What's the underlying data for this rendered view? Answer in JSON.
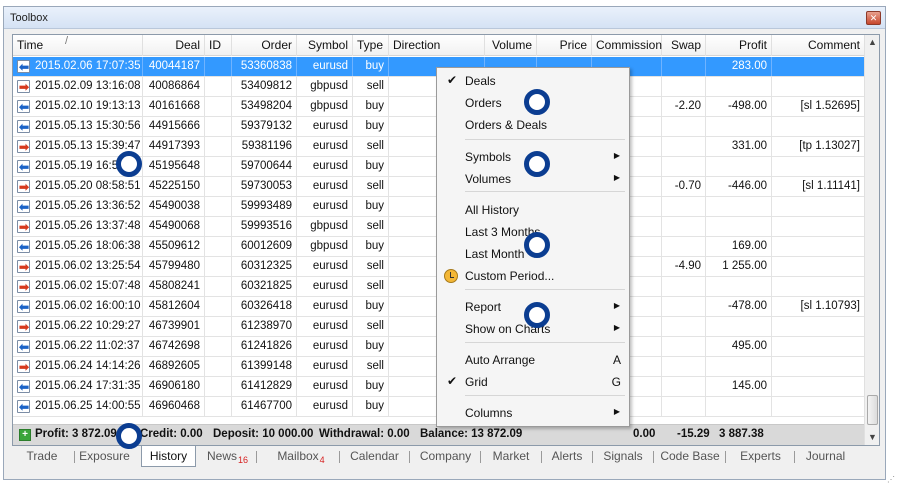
{
  "window": {
    "title": "Toolbox",
    "close_icon": "close-icon"
  },
  "columns": [
    "Time",
    "Deal",
    "ID",
    "Order",
    "Symbol",
    "Type",
    "Direction",
    "Volume",
    "Price",
    "Commission",
    "Swap",
    "Profit",
    "Comment"
  ],
  "sort_indicator": "/",
  "rows": [
    {
      "time": "2015.02.06 17:07:35",
      "deal": "40044187",
      "order": "53360838",
      "symbol": "eurusd",
      "type": "buy",
      "swap": "",
      "profit": "283.00",
      "comment": ""
    },
    {
      "time": "2015.02.09 13:16:08",
      "deal": "40086864",
      "order": "53409812",
      "symbol": "gbpusd",
      "type": "sell",
      "swap": "",
      "profit": "",
      "comment": ""
    },
    {
      "time": "2015.02.10 19:13:13",
      "deal": "40161668",
      "order": "53498204",
      "symbol": "gbpusd",
      "type": "buy",
      "swap": "-2.20",
      "profit": "-498.00",
      "comment": "[sl 1.52695]"
    },
    {
      "time": "2015.05.13 15:30:56",
      "deal": "44915666",
      "order": "59379132",
      "symbol": "eurusd",
      "type": "buy",
      "swap": "",
      "profit": "",
      "comment": ""
    },
    {
      "time": "2015.05.13 15:39:47",
      "deal": "44917393",
      "order": "59381196",
      "symbol": "eurusd",
      "type": "sell",
      "swap": "",
      "profit": "331.00",
      "comment": "[tp 1.13027]"
    },
    {
      "time": "2015.05.19 16:53:40",
      "deal": "45195648",
      "order": "59700644",
      "symbol": "eurusd",
      "type": "buy",
      "swap": "",
      "profit": "",
      "comment": ""
    },
    {
      "time": "2015.05.20 08:58:51",
      "deal": "45225150",
      "order": "59730053",
      "symbol": "eurusd",
      "type": "sell",
      "swap": "-0.70",
      "profit": "-446.00",
      "comment": "[sl 1.11141]"
    },
    {
      "time": "2015.05.26 13:36:52",
      "deal": "45490038",
      "order": "59993489",
      "symbol": "eurusd",
      "type": "buy",
      "swap": "",
      "profit": "",
      "comment": ""
    },
    {
      "time": "2015.05.26 13:37:48",
      "deal": "45490068",
      "order": "59993516",
      "symbol": "gbpusd",
      "type": "sell",
      "swap": "",
      "profit": "",
      "comment": ""
    },
    {
      "time": "2015.05.26 18:06:38",
      "deal": "45509612",
      "order": "60012609",
      "symbol": "gbpusd",
      "type": "buy",
      "swap": "",
      "profit": "169.00",
      "comment": ""
    },
    {
      "time": "2015.06.02 13:25:54",
      "deal": "45799480",
      "order": "60312325",
      "symbol": "eurusd",
      "type": "sell",
      "swap": "-4.90",
      "profit": "1 255.00",
      "comment": ""
    },
    {
      "time": "2015.06.02 15:07:48",
      "deal": "45808241",
      "order": "60321825",
      "symbol": "eurusd",
      "type": "sell",
      "swap": "",
      "profit": "",
      "comment": ""
    },
    {
      "time": "2015.06.02 16:00:10",
      "deal": "45812604",
      "order": "60326418",
      "symbol": "eurusd",
      "type": "buy",
      "swap": "",
      "profit": "-478.00",
      "comment": "[sl 1.10793]"
    },
    {
      "time": "2015.06.22 10:29:27",
      "deal": "46739901",
      "order": "61238970",
      "symbol": "eurusd",
      "type": "sell",
      "swap": "",
      "profit": "",
      "comment": ""
    },
    {
      "time": "2015.06.22 11:02:37",
      "deal": "46742698",
      "order": "61241826",
      "symbol": "eurusd",
      "type": "buy",
      "swap": "",
      "profit": "495.00",
      "comment": ""
    },
    {
      "time": "2015.06.24 14:14:26",
      "deal": "46892605",
      "order": "61399148",
      "symbol": "eurusd",
      "type": "sell",
      "swap": "",
      "profit": "",
      "comment": ""
    },
    {
      "time": "2015.06.24 17:31:35",
      "deal": "46906180",
      "order": "61412829",
      "symbol": "eurusd",
      "type": "buy",
      "swap": "",
      "profit": "145.00",
      "comment": ""
    },
    {
      "time": "2015.06.25 14:00:55",
      "deal": "46960468",
      "order": "61467700",
      "symbol": "eurusd",
      "type": "buy",
      "swap": "",
      "profit": "",
      "comment": ""
    }
  ],
  "summary": {
    "profit": "Profit: 3 872.09",
    "credit": "Credit: 0.00",
    "deposit": "Deposit: 10 000.00",
    "withdrawal": "Withdrawal: 0.00",
    "balance": "Balance: 13 872.09",
    "commission": "0.00",
    "swap": "-15.29",
    "total_profit": "3 887.38"
  },
  "menu": [
    {
      "label": "Deals",
      "checked": true
    },
    {
      "label": "Orders"
    },
    {
      "label": "Orders & Deals"
    },
    {
      "label": "Symbols",
      "submenu": true
    },
    {
      "label": "Volumes",
      "submenu": true
    },
    {
      "label": "All History"
    },
    {
      "label": "Last 3 Months"
    },
    {
      "label": "Last Month"
    },
    {
      "label": "Custom Period..."
    },
    {
      "label": "Report",
      "submenu": true
    },
    {
      "label": "Show on Charts",
      "submenu": true
    },
    {
      "label": "Auto Arrange",
      "key": "A"
    },
    {
      "label": "Grid",
      "checked": true,
      "key": "G"
    },
    {
      "label": "Columns",
      "submenu": true
    }
  ],
  "tabs": [
    {
      "label": "Trade"
    },
    {
      "label": "Exposure"
    },
    {
      "label": "History",
      "active": true
    },
    {
      "label": "News",
      "badge": "16"
    },
    {
      "label": "Mailbox",
      "badge": "4"
    },
    {
      "label": "Calendar"
    },
    {
      "label": "Company"
    },
    {
      "label": "Market"
    },
    {
      "label": "Alerts"
    },
    {
      "label": "Signals"
    },
    {
      "label": "Code Base"
    },
    {
      "label": "Experts"
    },
    {
      "label": "Journal"
    }
  ],
  "colors": {
    "selection": "#3399ff",
    "marker": "#0b3d91",
    "badge": "#d62020"
  }
}
